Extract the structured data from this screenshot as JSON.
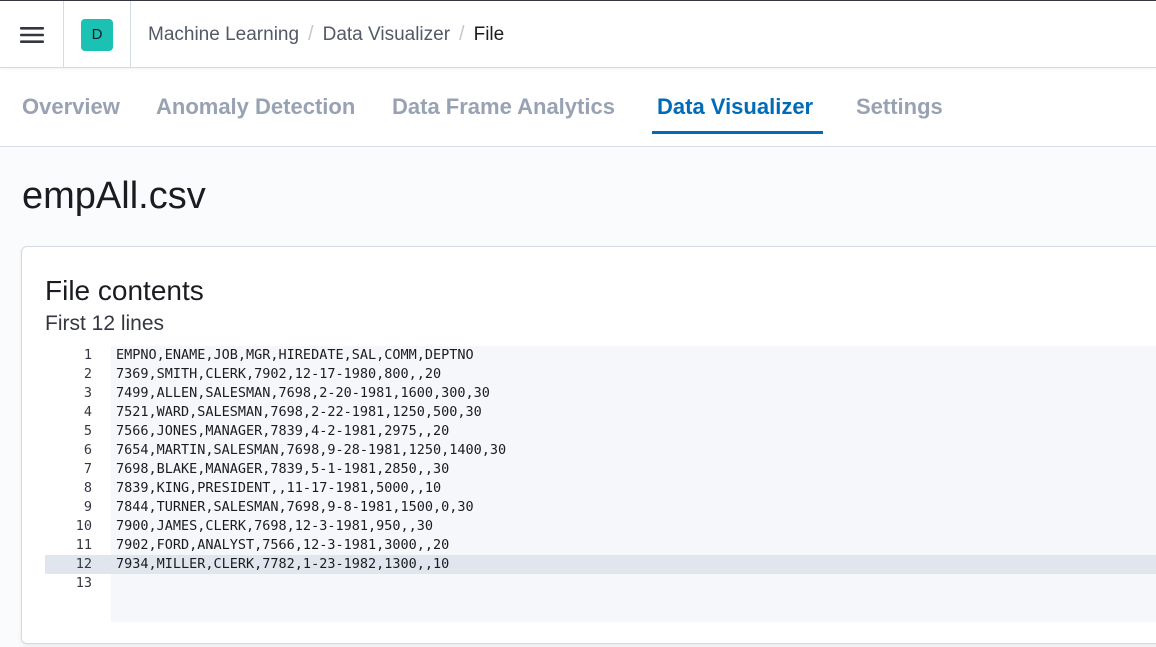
{
  "header": {
    "menu_icon": "hamburger-menu-icon",
    "space_initial": "D",
    "space_color": "#1bc2b4",
    "breadcrumbs": [
      {
        "label": "Machine Learning"
      },
      {
        "label": "Data Visualizer"
      },
      {
        "label": "File"
      }
    ],
    "separator": "/"
  },
  "tabs": [
    {
      "label": "Overview",
      "active": false
    },
    {
      "label": "Anomaly Detection",
      "active": false
    },
    {
      "label": "Data Frame Analytics",
      "active": false
    },
    {
      "label": "Data Visualizer",
      "active": true
    },
    {
      "label": "Settings",
      "active": false
    }
  ],
  "colors": {
    "accent": "#006bb8",
    "inactive_tab": "#98a2b3"
  },
  "page": {
    "title": "empAll.csv"
  },
  "file_contents": {
    "title": "File contents",
    "subtitle": "First 12 lines",
    "highlighted_line": 12,
    "lines": [
      {
        "num": "1",
        "text": "EMPNO,ENAME,JOB,MGR,HIREDATE,SAL,COMM,DEPTNO"
      },
      {
        "num": "2",
        "text": "7369,SMITH,CLERK,7902,12-17-1980,800,,20"
      },
      {
        "num": "3",
        "text": "7499,ALLEN,SALESMAN,7698,2-20-1981,1600,300,30"
      },
      {
        "num": "4",
        "text": "7521,WARD,SALESMAN,7698,2-22-1981,1250,500,30"
      },
      {
        "num": "5",
        "text": "7566,JONES,MANAGER,7839,4-2-1981,2975,,20"
      },
      {
        "num": "6",
        "text": "7654,MARTIN,SALESMAN,7698,9-28-1981,1250,1400,30"
      },
      {
        "num": "7",
        "text": "7698,BLAKE,MANAGER,7839,5-1-1981,2850,,30"
      },
      {
        "num": "8",
        "text": "7839,KING,PRESIDENT,,11-17-1981,5000,,10"
      },
      {
        "num": "9",
        "text": "7844,TURNER,SALESMAN,7698,9-8-1981,1500,0,30"
      },
      {
        "num": "10",
        "text": "7900,JAMES,CLERK,7698,12-3-1981,950,,30"
      },
      {
        "num": "11",
        "text": "7902,FORD,ANALYST,7566,12-3-1981,3000,,20"
      },
      {
        "num": "12",
        "text": "7934,MILLER,CLERK,7782,1-23-1982,1300,,10"
      },
      {
        "num": "13",
        "text": ""
      }
    ]
  }
}
